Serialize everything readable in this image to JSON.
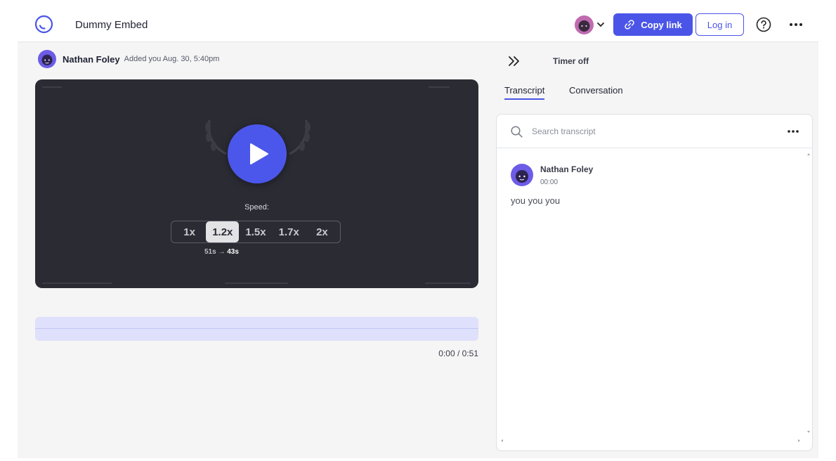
{
  "app": {
    "title": "Dummy Embed"
  },
  "header": {
    "copy_link_label": "Copy link",
    "login_label": "Log in"
  },
  "recording": {
    "author": "Nathan Foley",
    "meta": "Added you Aug. 30, 5:40pm"
  },
  "player": {
    "speed_label": "Speed:",
    "speed_options": [
      "1x",
      "1.2x",
      "1.5x",
      "1.7x",
      "2x"
    ],
    "selected_speed": "1.2x",
    "speed_time_from": "51s",
    "speed_time_to": "43s",
    "time_readout": "0:00 / 0:51",
    "progress": 0
  },
  "side": {
    "timer_label": "Timer off",
    "tabs": [
      "Transcript",
      "Conversation"
    ],
    "active_tab": "Transcript"
  },
  "transcript": {
    "search_placeholder": "Search transcript",
    "entries": [
      {
        "speaker": "Nathan Foley",
        "time": "00:00",
        "text": "you you you"
      }
    ]
  },
  "colors": {
    "accent": "#4a55e8",
    "video_bg": "#2a2b33",
    "progress_bg": "#dfe0fb",
    "avatar": "#6c5ce7"
  },
  "icons": {
    "logo": "loading-ring-logo",
    "copy": "link-icon",
    "help": "question-circle-icon",
    "more": "ellipsis-icon",
    "play": "play-icon",
    "collapse": "double-chevron-right-icon",
    "search": "search-icon"
  }
}
